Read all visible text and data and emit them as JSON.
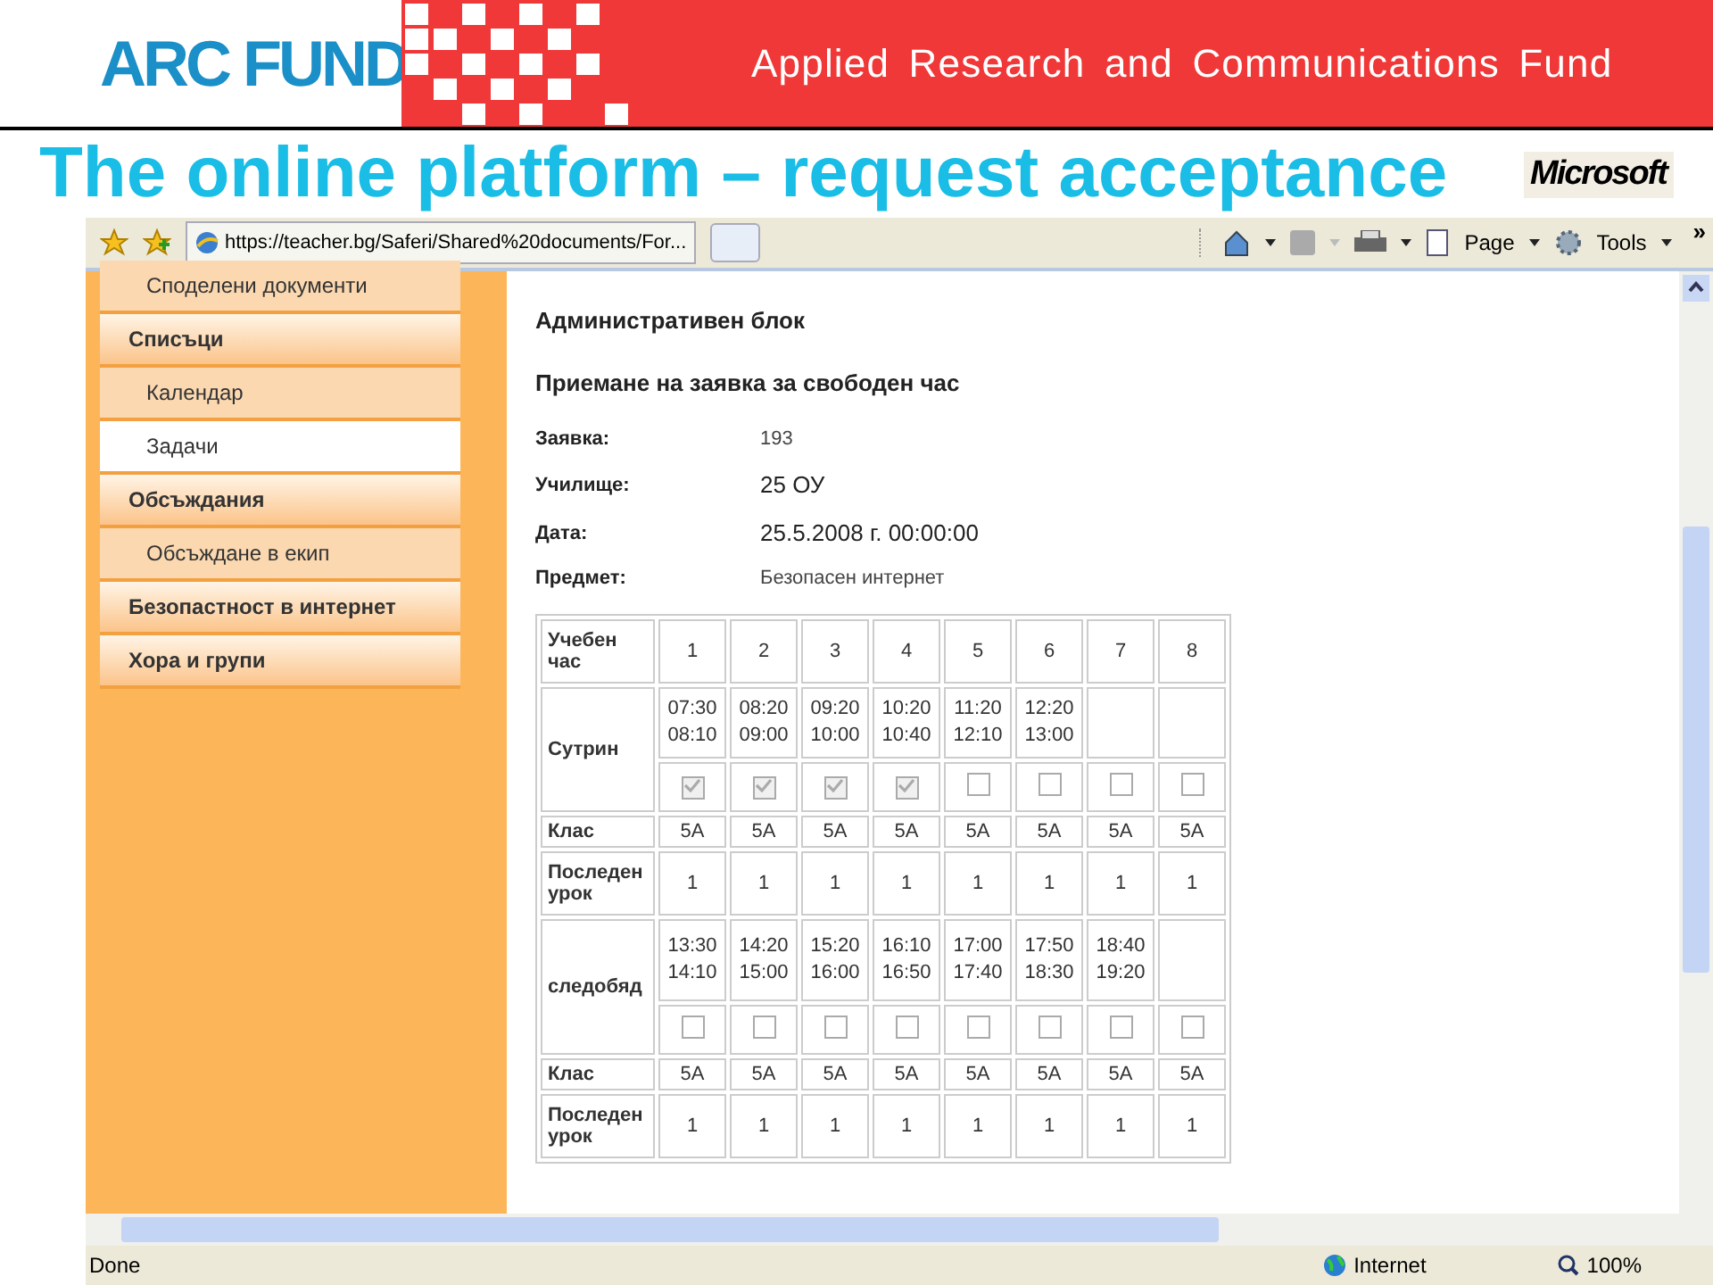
{
  "header": {
    "logo": "ARC FUND",
    "tagline": "Applied Research and Communications Fund"
  },
  "slide_title": "The online platform – request acceptance",
  "partner_logo": "Microsoft",
  "browser": {
    "address": "https://teacher.bg/Saferi/Shared%20documents/For...",
    "toolbar": [
      "Page",
      "Tools"
    ],
    "overflow": "»"
  },
  "sidebar": {
    "items": [
      {
        "kind": "item",
        "label": "Споделени документи",
        "selected": false
      },
      {
        "kind": "heading",
        "label": "Списъци",
        "selected": false
      },
      {
        "kind": "item",
        "label": "Календар",
        "selected": false
      },
      {
        "kind": "item",
        "label": "Задачи",
        "selected": true
      },
      {
        "kind": "heading",
        "label": "Обсъждания",
        "selected": false
      },
      {
        "kind": "item",
        "label": "Обсъждане в екип",
        "selected": false
      },
      {
        "kind": "heading",
        "label": "Безопастност в интернет",
        "selected": false
      },
      {
        "kind": "heading",
        "label": "Хора и групи",
        "selected": false
      }
    ]
  },
  "content": {
    "title": "Административен блок",
    "subtitle": "Приемане на заявка за свободен час",
    "fields": [
      {
        "label": "Заявка:",
        "value": "193",
        "kind": "small"
      },
      {
        "label": "Училище:",
        "value": "25 ОУ",
        "kind": "large"
      },
      {
        "label": "Дата:",
        "value": "25.5.2008 г. 00:00:00",
        "kind": "large"
      },
      {
        "label": "Предмет:",
        "value": "Безопасен интернет",
        "kind": "small"
      }
    ],
    "table": {
      "hour_label": "Учебен час",
      "hours": [
        "1",
        "2",
        "3",
        "4",
        "5",
        "6",
        "7",
        "8"
      ],
      "sessions": [
        {
          "label": "Сутрин",
          "slots": [
            {
              "start": "07:30",
              "end": "08:10",
              "checked": true
            },
            {
              "start": "08:20",
              "end": "09:00",
              "checked": true
            },
            {
              "start": "09:20",
              "end": "10:00",
              "checked": true
            },
            {
              "start": "10:20",
              "end": "10:40",
              "checked": true
            },
            {
              "start": "11:20",
              "end": "12:10",
              "checked": false
            },
            {
              "start": "12:20",
              "end": "13:00",
              "checked": false
            },
            {
              "checked": false
            },
            {
              "checked": false
            }
          ],
          "class_label": "Клас",
          "classes": [
            "5A",
            "5A",
            "5A",
            "5A",
            "5A",
            "5A",
            "5A",
            "5A"
          ],
          "last_label": "Последен урок",
          "last": [
            "1",
            "1",
            "1",
            "1",
            "1",
            "1",
            "1",
            "1"
          ]
        },
        {
          "label": "следобяд",
          "slots": [
            {
              "start": "13:30",
              "end": "14:10",
              "checked": false
            },
            {
              "start": "14:20",
              "end": "15:00",
              "checked": false
            },
            {
              "start": "15:20",
              "end": "16:00",
              "checked": false
            },
            {
              "start": "16:10",
              "end": "16:50",
              "checked": false
            },
            {
              "start": "17:00",
              "end": "17:40",
              "checked": false
            },
            {
              "start": "17:50",
              "end": "18:30",
              "checked": false
            },
            {
              "start": "18:40",
              "end": "19:20",
              "checked": false
            },
            {
              "checked": false
            }
          ],
          "class_label": "Клас",
          "classes": [
            "5A",
            "5A",
            "5A",
            "5A",
            "5A",
            "5A",
            "5A",
            "5A"
          ],
          "last_label": "Последен урок",
          "last": [
            "1",
            "1",
            "1",
            "1",
            "1",
            "1",
            "1",
            "1"
          ]
        }
      ]
    }
  },
  "status_bar": {
    "text": "Done",
    "zone": "Internet",
    "zoom": "100%"
  }
}
